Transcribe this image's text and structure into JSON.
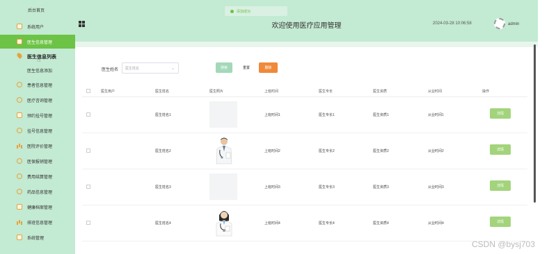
{
  "sidebar": {
    "header": "后台首页",
    "items": [
      {
        "label": "系统用户",
        "icon": "square-icon"
      },
      {
        "label": "医生信息管理",
        "icon": "square-icon"
      },
      {
        "label": "患者信息管理",
        "icon": "circle-icon"
      },
      {
        "label": "医疗咨询管理",
        "icon": "circle-icon"
      },
      {
        "label": "预约挂号管理",
        "icon": "square-icon"
      },
      {
        "label": "挂号信息管理",
        "icon": "circle-icon"
      },
      {
        "label": "医院评价管理",
        "icon": "bars-icon"
      },
      {
        "label": "医保报销管理",
        "icon": "circle-icon"
      },
      {
        "label": "费用结算管理",
        "icon": "circle-icon"
      },
      {
        "label": "药品信息管理",
        "icon": "circle-icon"
      },
      {
        "label": "健康档案管理",
        "icon": "square-icon"
      },
      {
        "label": "排班信息管理",
        "icon": "bars-icon"
      },
      {
        "label": "系统管理",
        "icon": "square-icon"
      }
    ],
    "submenu": [
      {
        "label": "医生信息列表"
      },
      {
        "label": "医生信息添加"
      }
    ]
  },
  "header": {
    "toast": "添加成功",
    "title": "欢迎使用医疗应用管理",
    "datetime": "2024-03-28 10:06:58",
    "user": "admin"
  },
  "search": {
    "label": "医生姓名",
    "placeholder": "医生姓名",
    "search_label": "搜索",
    "reset_label": "重置",
    "delete_label": "删除"
  },
  "table": {
    "columns": [
      "医生用户",
      "医生姓名",
      "医生照片",
      "上班时间",
      "医生专长",
      "医生资质",
      "从业时间",
      "操作"
    ],
    "rows": [
      {
        "user": "",
        "name": "医生姓名1",
        "photo": "blank",
        "work_time": "上班时间1",
        "specialty": "医生专长1",
        "qualification": "医生资质1",
        "years": "从业时间1",
        "action": "详情"
      },
      {
        "user": "",
        "name": "医生姓名2",
        "photo": "male-doctor",
        "work_time": "上班时间2",
        "specialty": "医生专长2",
        "qualification": "医生资质2",
        "years": "从业时间2",
        "action": "详情"
      },
      {
        "user": "",
        "name": "医生姓名3",
        "photo": "blank",
        "work_time": "上班时间3",
        "specialty": "医生专长3",
        "qualification": "医生资质3",
        "years": "从业时间3",
        "action": "详情"
      },
      {
        "user": "",
        "name": "医生姓名4",
        "photo": "female-doctor",
        "work_time": "上班时间4",
        "specialty": "医生专长4",
        "qualification": "医生资质4",
        "years": "从业时间4",
        "action": "详情"
      }
    ]
  },
  "watermark": "CSDN @bysj703",
  "colors": {
    "sidebar_bg": "#c3ead2",
    "active_green": "#6cc345",
    "accent_orange": "#f0893a",
    "detail_button": "#a3d47c"
  }
}
